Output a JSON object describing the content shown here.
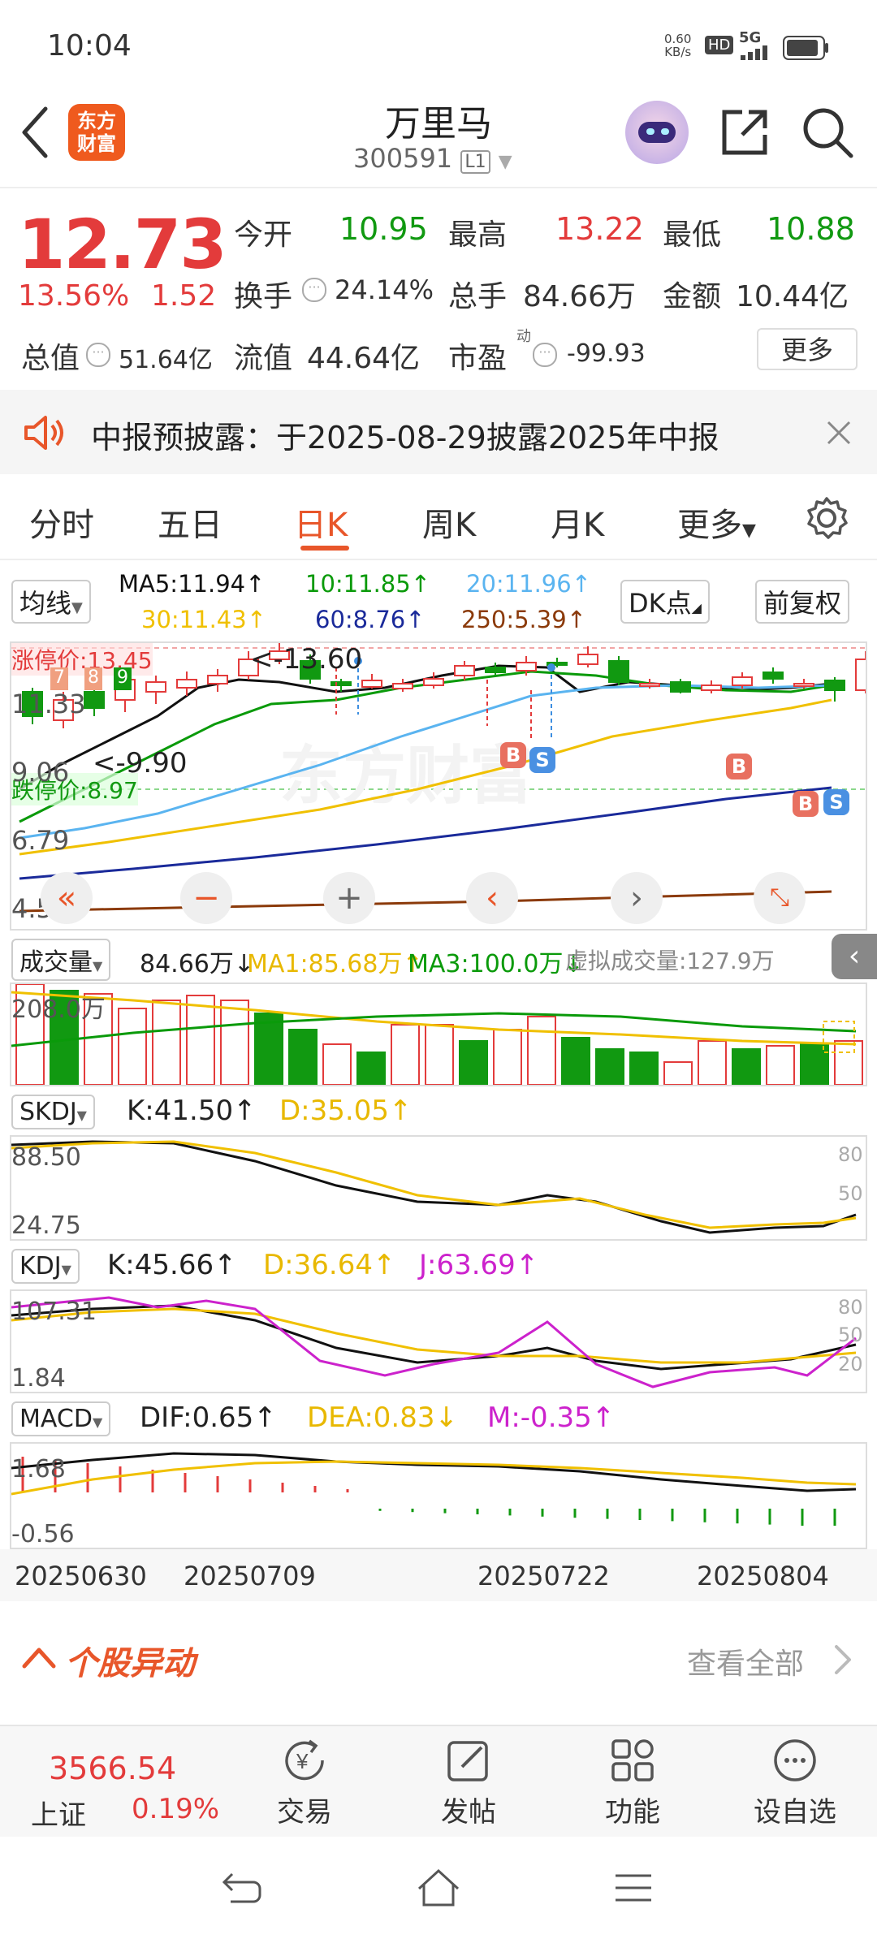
{
  "status": {
    "time": "10:04",
    "net_speed_top": "0.60",
    "net_speed_unit": "KB/s",
    "hd": "HD",
    "sig": "5G"
  },
  "header": {
    "stock_name": "万里马",
    "stock_code": "300591",
    "level": "L1",
    "brand_line1": "东方",
    "brand_line2": "财富"
  },
  "quote": {
    "price": "12.73",
    "change_pct": "13.56%",
    "change": "1.52",
    "open_label": "今开",
    "open": "10.95",
    "high_label": "最高",
    "high": "13.22",
    "low_label": "最低",
    "low": "10.88",
    "turnover_label": "换手",
    "turnover": "24.14%",
    "volume_label": "总手",
    "volume": "84.66万",
    "amount_label": "金额",
    "amount": "10.44亿",
    "mktcap_label": "总值",
    "mktcap": "51.64亿",
    "float_label": "流值",
    "float": "44.64亿",
    "pe_label": "市盈",
    "pe_sup": "动",
    "pe": "-99.93",
    "more": "更多"
  },
  "notice": {
    "text": "中报预披露：于2025-08-29披露2025年中报"
  },
  "tabs": [
    "分时",
    "五日",
    "日K",
    "周K",
    "月K",
    "更多"
  ],
  "active_tab": "日K",
  "ma_bar": {
    "label": "均线",
    "ma5": "MA5:11.94↑",
    "ma10": "10:11.85↑",
    "ma20": "20:11.96↑",
    "ma30": "30:11.43↑",
    "ma60": "60:8.76↑",
    "ma250": "250:5.39↑",
    "dk": "DK点",
    "adj": "前复权"
  },
  "kline": {
    "limit_up": "涨停价:13.45",
    "limit_down": "跌停价:8.97",
    "y1": "11.33",
    "y2": "9.06",
    "y3": "6.79",
    "y4": "4.52",
    "max_note": "<-13.60",
    "min_note": "<-9.90",
    "b_label": "B",
    "s_label": "S",
    "nums": [
      "7",
      "8",
      "9"
    ],
    "watermark": "东方财富"
  },
  "volume": {
    "label": "成交量",
    "val": "84.66万↓",
    "ma1": "MA1:85.68万↑",
    "ma3": "MA3:100.0万↓",
    "virtual": "虚拟成交量:127.9万",
    "axis": "208.0万"
  },
  "skdj": {
    "label": "SKDJ",
    "k": "K:41.50↑",
    "d": "D:35.05↑",
    "y_top": "88.50",
    "y_bot": "24.75",
    "r80": "80",
    "r50": "50"
  },
  "kdj": {
    "label": "KDJ",
    "k": "K:45.66↑",
    "d": "D:36.64↑",
    "j": "J:63.69↑",
    "y_top": "107.31",
    "y_bot": "1.84",
    "r80": "80",
    "r50": "50",
    "r20": "20"
  },
  "macd": {
    "label": "MACD",
    "dif": "DIF:0.65↑",
    "dea": "DEA:0.83↓",
    "m": "M:-0.35↑",
    "y_top": "1.68",
    "y_bot": "-0.56"
  },
  "dates": [
    "20250630",
    "20250709",
    "20250722",
    "20250804"
  ],
  "abnormal": {
    "title": "个股异动",
    "view_all": "查看全部"
  },
  "bottom": {
    "index_value": "3566.54",
    "index_name": "上证",
    "index_change": "0.19%",
    "trade": "交易",
    "post": "发帖",
    "func": "功能",
    "watch": "设自选"
  },
  "colors": {
    "up": "#e33b3b",
    "down": "#119911",
    "accent": "#e8562a",
    "ma5": "#111111",
    "ma10": "#0a9a0a",
    "ma20": "#5ab4f0",
    "ma30": "#f0c000",
    "ma60": "#1a2a9a",
    "ma250": "#8b3a0a"
  }
}
